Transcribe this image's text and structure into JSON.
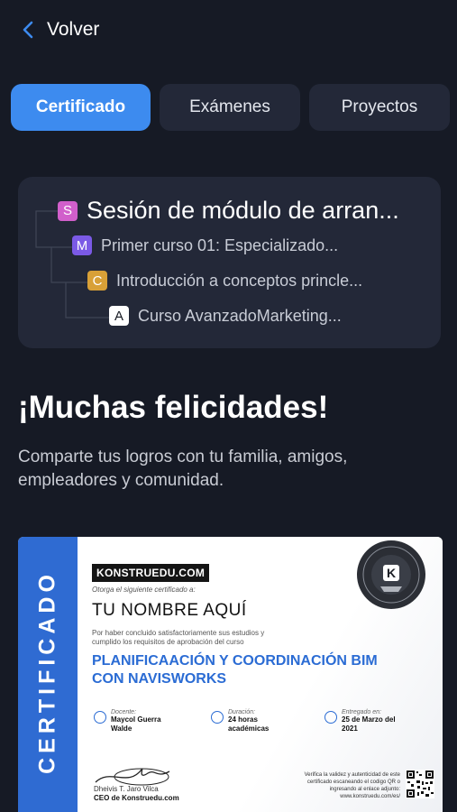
{
  "header": {
    "back_label": "Volver"
  },
  "tabs": [
    {
      "label": "Certificado",
      "active": true
    },
    {
      "label": "Exámenes",
      "active": false
    },
    {
      "label": "Proyectos",
      "active": false
    }
  ],
  "tree": {
    "items": [
      {
        "badge": "S",
        "badge_color": "#d15fcb",
        "label": "Sesión de módulo de arran..."
      },
      {
        "badge": "M",
        "badge_color": "#7b5ae6",
        "label": "Primer curso 01: Especializado..."
      },
      {
        "badge": "C",
        "badge_color": "#d8a037",
        "label": "Introducción a conceptos princle..."
      },
      {
        "badge": "A",
        "badge_color": "#ffffff",
        "label": "Curso AvanzadoMarketing..."
      }
    ]
  },
  "congrats": {
    "title": "¡Muchas felicidades!",
    "subtitle": "Comparte tus logros con tu familia, amigos, empleadores y comunidad."
  },
  "certificate": {
    "side_label": "CERTIFICADO",
    "brand": "KONSTRUEDU.COM",
    "grants": "Otorga el siguiente certificado a:",
    "recipient": "TU NOMBRE AQUÍ",
    "description": "Por haber concluido satisfactoriamente sus estudios y cumplido los requisitos de aprobación del curso",
    "course": "PLANIFICAACIÓN Y COORDINACIÓN BIM CON NAVISWORKS",
    "teacher_label": "Docente:",
    "teacher": "Maycol Guerra Walde",
    "duration_label": "Duración:",
    "duration": "24 horas académicas",
    "delivered_label": "Entregado en:",
    "delivered": "25 de Marzo del 2021",
    "signer": "Dheivis T. Jaro Vilca",
    "signer_role": "CEO de Konstruedu.com",
    "verify_text": "Verifica la validez y autenticidad de este certificado escaneando el codigo QR o ingresando al enlace adjunto: www.konstruedu.com/es/",
    "seal_letter": "K",
    "accent_color": "#2f6bd2"
  }
}
